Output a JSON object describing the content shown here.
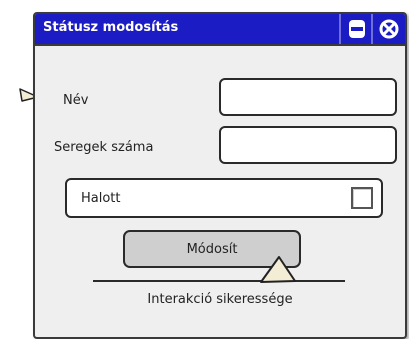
{
  "window": {
    "title": "Státusz modosítás",
    "minimize_icon": "minimize-icon",
    "close_icon": "close-x-icon",
    "title_bar_color": "#1c1cc4"
  },
  "form": {
    "name_label": "Név",
    "name_value": "",
    "army_count_label": "Seregek száma",
    "army_count_value": "",
    "dead_label": "Halott",
    "dead_checked": false,
    "submit_label": "Módosít"
  },
  "status": {
    "text": "Interakció sikeressége"
  }
}
